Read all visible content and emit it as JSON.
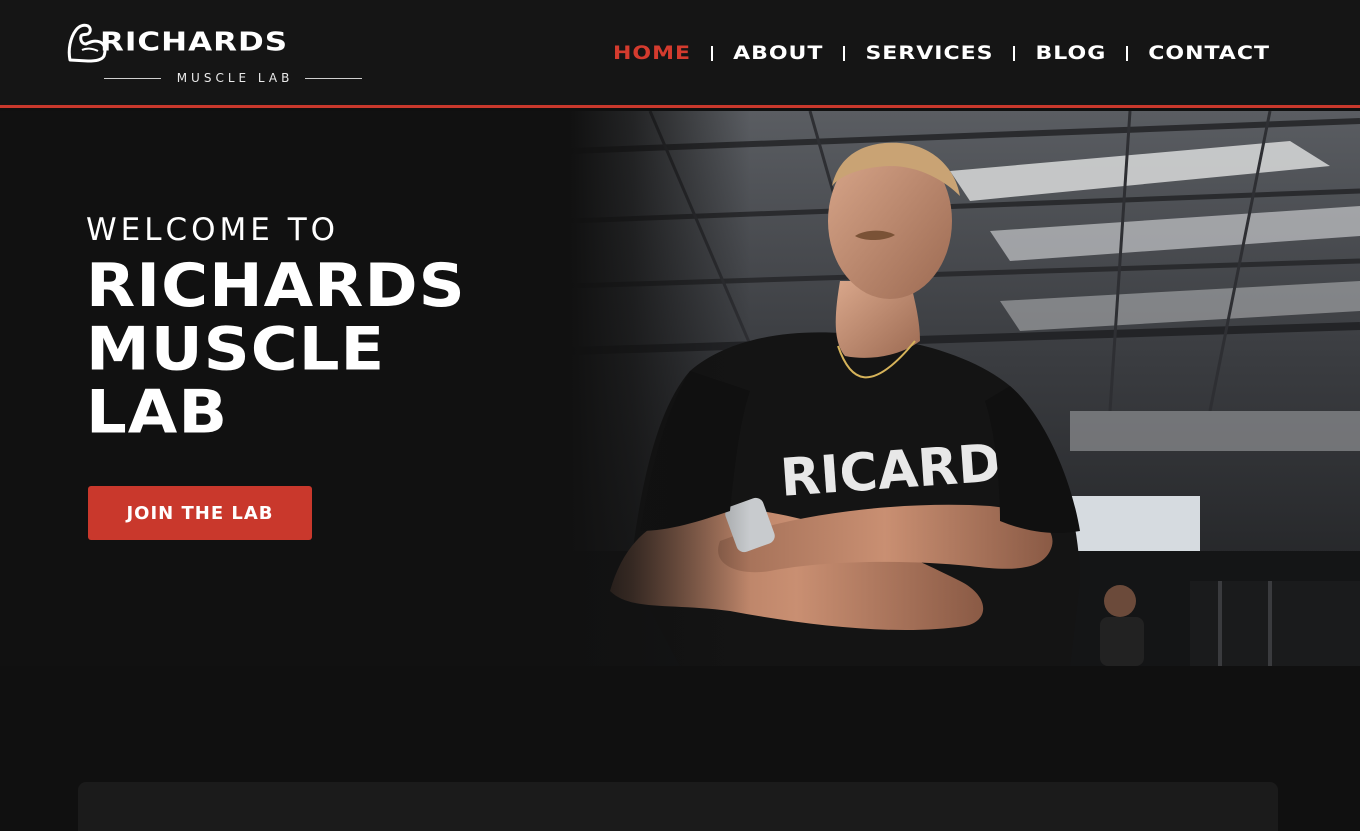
{
  "brand": {
    "name": "RICHARDS",
    "subtitle": "MUSCLE LAB",
    "logo_icon": "flexed-arm-icon"
  },
  "nav": {
    "items": [
      {
        "label": "HOME",
        "active": true
      },
      {
        "label": "ABOUT",
        "active": false
      },
      {
        "label": "SERVICES",
        "active": false
      },
      {
        "label": "BLOG",
        "active": false
      },
      {
        "label": "CONTACT",
        "active": false
      }
    ]
  },
  "hero": {
    "eyebrow": "WELCOME TO",
    "title_lines": [
      "RICHARDS",
      "MUSCLE",
      "LAB"
    ],
    "cta_label": "JOIN THE LAB"
  },
  "colors": {
    "accent": "#c9382c",
    "nav_active": "#d43b2e",
    "background": "#101010",
    "header_bg": "#151515"
  }
}
